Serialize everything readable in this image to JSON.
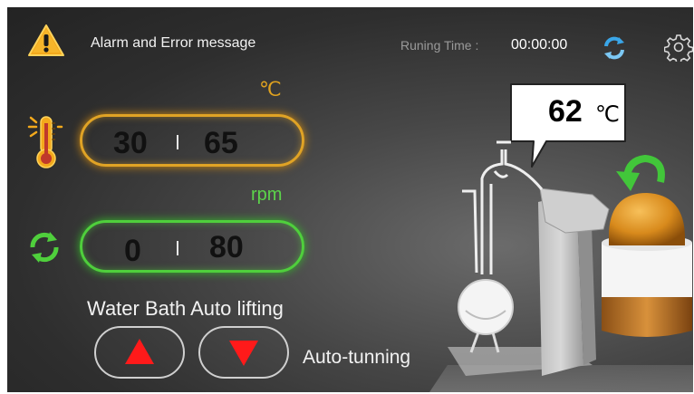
{
  "header": {
    "alarm_label": "Alarm and Error message",
    "running_time_label": "Runing Time :",
    "running_time_value": "00:00:00",
    "icons": [
      "warning-icon",
      "refresh-icon",
      "gear-icon"
    ]
  },
  "temperature": {
    "unit": "℃",
    "current": "30",
    "target": "65",
    "color": "#e0a325"
  },
  "rotation": {
    "unit": "rpm",
    "current": "0",
    "target": "80",
    "color": "#4fcf3c"
  },
  "water_bath": {
    "label": "Water Bath Auto lifting",
    "up_color": "#ff1a1a",
    "down_color": "#ff1a1a"
  },
  "auto_tuning_label": "Auto-tunning",
  "callout": {
    "value": "62",
    "unit": "℃"
  }
}
